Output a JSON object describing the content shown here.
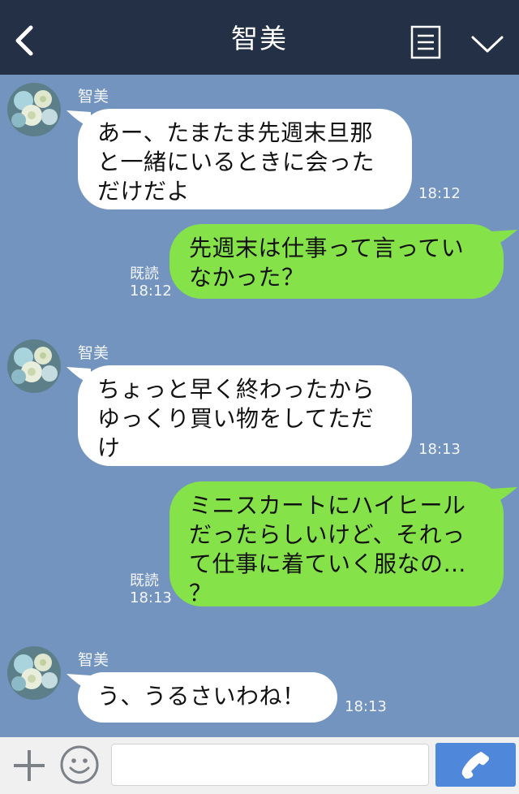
{
  "header": {
    "title": "智美",
    "back_icon": "chevron-left-icon",
    "menu_icon": "note-menu-icon",
    "collapse_icon": "chevron-down-icon"
  },
  "messages": [
    {
      "direction": "in",
      "sender": "智美",
      "lines": [
        "あー、たまたま先週末旦那",
        "と一緒にいるときに会った",
        "だけだよ"
      ],
      "time": "18:12"
    },
    {
      "direction": "out",
      "read": "既読",
      "lines": [
        "先週末は仕事って言ってい",
        "なかった？"
      ],
      "time": "18:12"
    },
    {
      "direction": "in",
      "sender": "智美",
      "lines": [
        "ちょっと早く終わったから",
        "ゆっくり買い物をしてただ",
        "け"
      ],
      "time": "18:13"
    },
    {
      "direction": "out",
      "read": "既読",
      "lines": [
        "ミニスカートにハイヒール",
        "だったらしいけど、それっ",
        "て仕事に着ていく服なの…",
        "？"
      ],
      "time": "18:13"
    },
    {
      "direction": "in",
      "sender": "智美",
      "lines": [
        "う、うるさいわね！"
      ],
      "time": "18:13"
    }
  ],
  "inputbar": {
    "placeholder": "",
    "value": "",
    "icons": [
      "plus-icon",
      "smile-icon",
      "phone-icon"
    ]
  },
  "colors": {
    "header": "#243045",
    "background": "#7494c0",
    "incoming_bubble": "#ffffff",
    "outgoing_bubble": "#85e249",
    "call_button": "#4f87db"
  }
}
